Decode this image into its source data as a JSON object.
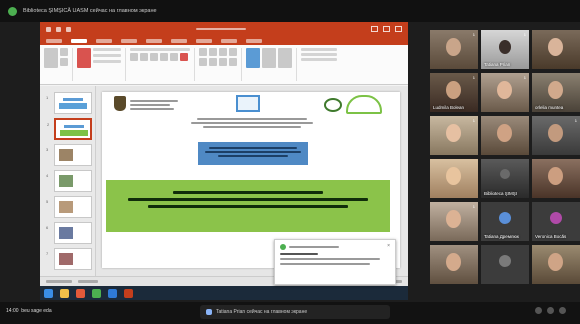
{
  "meeting": {
    "top_banner": "Biblioteca ŞIMŞICĂ UASM сейчас на главном экране",
    "bottom_speaking": "Tatiana Prian сейчас на главном экране",
    "time": "14:00",
    "bottom_left_label": "beu sage eda"
  },
  "accent_colors": {
    "powerpoint": "#c43e1c",
    "slide_blue": "#4f89c4",
    "slide_green": "#8bc34a"
  },
  "participants": [
    {
      "name": "",
      "num": "1"
    },
    {
      "name": "Tatiana Prian",
      "num": "1"
    },
    {
      "name": "",
      "num": ""
    },
    {
      "name": "Ludmila Bolean",
      "num": "1"
    },
    {
      "name": "",
      "num": "1"
    },
    {
      "name": "orlelia muntea",
      "num": ""
    },
    {
      "name": "",
      "num": "1"
    },
    {
      "name": "",
      "num": ""
    },
    {
      "name": "",
      "num": "1"
    },
    {
      "name": "",
      "num": ""
    },
    {
      "name": "Biblioteca ŞIMŞI",
      "num": ""
    },
    {
      "name": "",
      "num": ""
    },
    {
      "name": "",
      "num": "1"
    },
    {
      "name": "Tatiana Дремлюк",
      "num": ""
    },
    {
      "name": "Veronica Bocăs",
      "num": ""
    },
    {
      "name": "",
      "num": ""
    },
    {
      "name": "",
      "num": ""
    },
    {
      "name": "",
      "num": ""
    }
  ]
}
